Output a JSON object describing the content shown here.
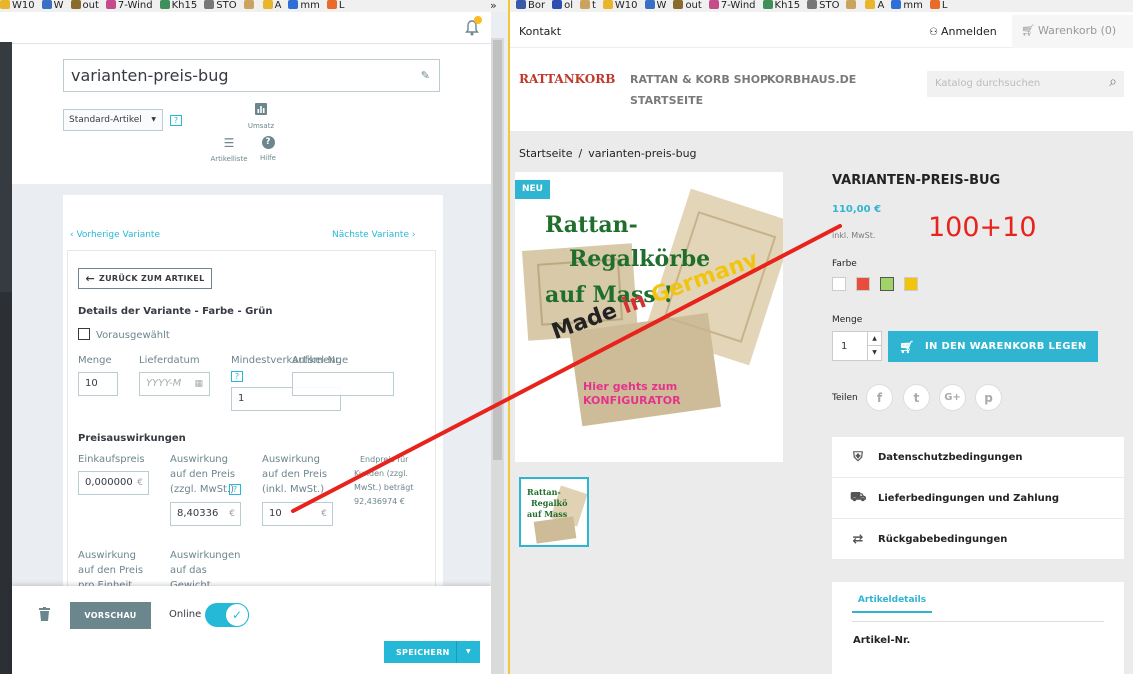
{
  "browser_left": {
    "bookmarks": [
      {
        "label": "W10",
        "color": "#e9b52a"
      },
      {
        "label": "W",
        "color": "#3a6fc4"
      },
      {
        "label": "out",
        "color": "#8a6b2e"
      },
      {
        "label": "7-Wind",
        "color": "#c44c8a"
      },
      {
        "label": "Kh15",
        "color": "#3e8f5a"
      },
      {
        "label": "STO",
        "color": "#777777"
      },
      {
        "label": "",
        "color": "#caa45c"
      },
      {
        "label": "A",
        "color": "#e9b52a"
      },
      {
        "label": "mm",
        "color": "#2f6fd6"
      },
      {
        "label": "L",
        "color": "#e86b2a"
      }
    ],
    "overflow": "»"
  },
  "browser_right": {
    "bookmarks": [
      {
        "label": "Bor",
        "color": "#3a5aa8"
      },
      {
        "label": "ol",
        "color": "#2f4fb0"
      },
      {
        "label": "t",
        "color": "#caa45c"
      },
      {
        "label": "W10",
        "color": "#e9b52a"
      },
      {
        "label": "W",
        "color": "#3a6fc4"
      },
      {
        "label": "out",
        "color": "#8a6b2e"
      },
      {
        "label": "7-Wind",
        "color": "#c44c8a"
      },
      {
        "label": "Kh15",
        "color": "#3e8f5a"
      },
      {
        "label": "STO",
        "color": "#777777"
      },
      {
        "label": "",
        "color": "#caa45c"
      },
      {
        "label": "A",
        "color": "#e9b52a"
      },
      {
        "label": "mm",
        "color": "#2f6fd6"
      },
      {
        "label": "L",
        "color": "#e86b2a"
      }
    ]
  },
  "admin": {
    "notifications_count": "",
    "product_name": "varianten-preis-bug",
    "product_type": "Standard-Artikel",
    "help_mark": "?",
    "toolbar": {
      "sales": "Umsatz",
      "product_list": "Artikelliste",
      "help": "Hilfe"
    },
    "prev_variant": "Vorherige Variante",
    "next_variant": "Nächste Variante",
    "back_button": "ZURÜCK ZUM ARTIKEL",
    "details_title": "Details der Variante - Farbe - Grün",
    "preselected": "Vorausgewählt",
    "quantity_label": "Menge",
    "quantity": "10",
    "delivery_label": "Lieferdatum",
    "delivery_placeholder": "YYYY-M",
    "min_qty_label": "Mindestverkaufsmenge",
    "min_qty": "1",
    "sku_label": "Artikel-Nr.",
    "sku": "",
    "price_title": "Preisauswirkungen",
    "cost_label": "Einkaufspreis",
    "cost": "0,000000",
    "impact_excl_label": [
      "Auswirkung",
      "auf den Preis",
      "(zzgl. MwSt.)"
    ],
    "impact_excl": "8,40336",
    "impact_incl_label": [
      "Auswirkung",
      "auf den Preis",
      "(inkl. MwSt.)"
    ],
    "impact_incl": "10",
    "final_price_note": [
      "Endpreis für",
      "Kunden (zzgl.",
      "MwSt.) beträgt",
      "92,436974 €"
    ],
    "unit_impact_label": [
      "Auswirkung",
      "auf den Preis",
      "pro Einheit"
    ],
    "weight_impact_label": [
      "Auswirkungen",
      "auf das",
      "Gewicht"
    ],
    "currency": "€",
    "footer": {
      "preview": "VORSCHAU",
      "online": "Online",
      "save": "SPEICHERN"
    }
  },
  "shop": {
    "contact": "Kontakt",
    "login": "Anmelden",
    "cart": "Warenkorb (0)",
    "logo": "RATTANKORB",
    "nav": [
      "RATTAN & KORB SHOP",
      "KORBHAUS.DE",
      "STARTSEITE"
    ],
    "search_placeholder": "Katalog durchsuchen",
    "breadcrumb": [
      "Startseite",
      "varianten-preis-bug"
    ],
    "badge_new": "NEU",
    "image_text": {
      "line1": "Rattan-",
      "line2": "Regalkörbe",
      "line3": "auf Mass !",
      "made": "Made",
      "in": "in",
      "germany": "Germany",
      "cta1": "Hier gehts zum",
      "cta2": "KONFIGURATOR"
    },
    "thumb_text": [
      "Rattan-",
      "Regalkö",
      "auf Mass"
    ],
    "product_title": "VARIANTEN-PREIS-BUG",
    "price": "110,00 €",
    "tax_note": "inkl. MwSt.",
    "annotation": "100+10",
    "color_label": "Farbe",
    "swatches": [
      "#ffffff",
      "#e84c3d",
      "#a0d468",
      "#f1c40f"
    ],
    "quantity_label": "Menge",
    "quantity": "1",
    "add_to_cart": "IN DEN WARENKORB LEGEN",
    "share_label": "Teilen",
    "social": [
      "f",
      "t",
      "G+",
      "p"
    ],
    "reassurance": [
      "Datenschutzbedingungen",
      "Lieferbedingungen und Zahlung",
      "Rückgabebedingungen"
    ],
    "tab": "Artikeldetails",
    "detail_label": "Artikel-Nr."
  },
  "colors": {
    "accent": "#25b9d7",
    "brand_red": "#c0392b",
    "annotation_red": "#e8231c",
    "dark": "#363a41"
  }
}
